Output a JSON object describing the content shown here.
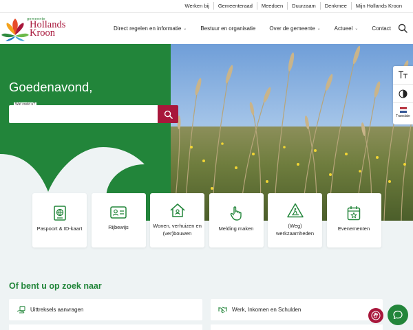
{
  "topnav": {
    "items": [
      "Werken bij",
      "Gemeenteraad",
      "Meedoen",
      "Duurzaam",
      "Denkmee",
      "Mijn Hollands Kroon"
    ]
  },
  "logo": {
    "small": "gemeente",
    "line1": "Hollands",
    "line2": "Kroon"
  },
  "mainnav": {
    "items": [
      {
        "label": "Direct regelen en informatie",
        "dropdown": true
      },
      {
        "label": "Bestuur en organisatie",
        "dropdown": false
      },
      {
        "label": "Over de gemeente",
        "dropdown": true
      },
      {
        "label": "Actueel",
        "dropdown": true
      },
      {
        "label": "Contact",
        "dropdown": false
      }
    ]
  },
  "hero": {
    "greeting": "Goedenavond,",
    "search_label": "Wat zoekt u?",
    "search_value": ""
  },
  "tools": {
    "translate_label": "Translate"
  },
  "cards": [
    {
      "label": "Paspoort & ID-kaart",
      "icon": "passport-icon"
    },
    {
      "label": "Rijbewijs",
      "icon": "id-card-icon"
    },
    {
      "label": "Wonen, verhuizen en (ver)bouwen",
      "icon": "house-icon"
    },
    {
      "label": "Melding maken",
      "icon": "hand-pointer-icon"
    },
    {
      "label": "(Weg) werkzaamheden",
      "icon": "roadwork-icon"
    },
    {
      "label": "Evenementen",
      "icon": "calendar-star-icon"
    }
  ],
  "section": {
    "title": "Of bent u op zoek naar",
    "links": [
      {
        "label": "Uittreksels aanvragen",
        "icon": "hand-document-icon"
      },
      {
        "label": "Werk, Inkomen en Schulden",
        "icon": "handshake-icon"
      }
    ]
  },
  "colors": {
    "green": "#22853a",
    "red": "#a8173b",
    "background": "#eef3f4"
  }
}
